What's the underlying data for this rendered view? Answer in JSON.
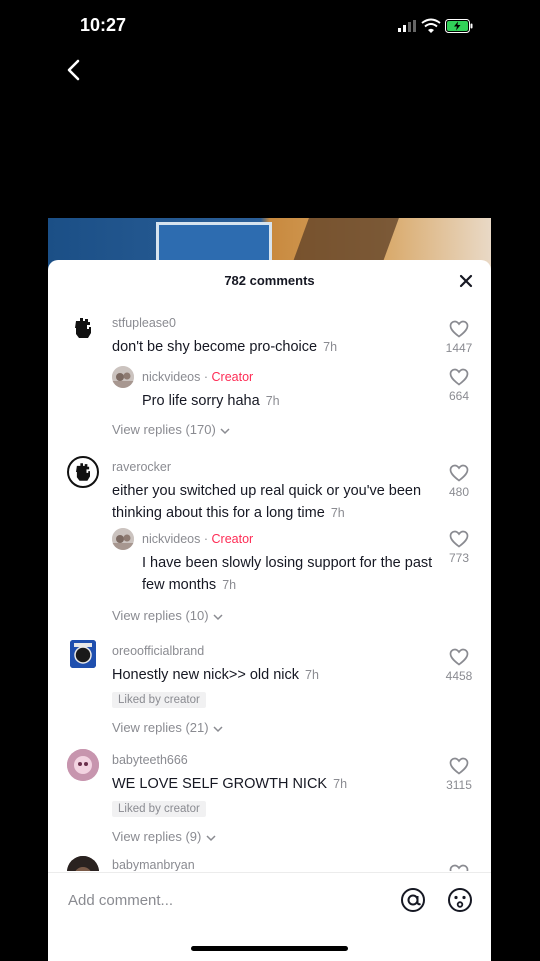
{
  "status_bar": {
    "time": "10:27"
  },
  "icons": {
    "back": "chevron-left-icon",
    "close": "close-icon",
    "like": "heart-outline-icon",
    "at": "at-mention-icon",
    "emoji": "emoji-icon",
    "expand": "chevron-down-icon"
  },
  "colors": {
    "creator": "#fe2c55",
    "secondary_text": "#8a8b91",
    "primary_text": "#161823"
  },
  "sheet": {
    "count_label": "782 comments"
  },
  "comments": [
    {
      "username": "stfuplease0",
      "text": "don't be shy become pro-choice",
      "time": "7h",
      "likes": "1447",
      "reply": {
        "username": "nickvideos",
        "creator_label": "Creator",
        "separator": "·",
        "text": "Pro life sorry haha",
        "time": "7h",
        "likes": "664"
      },
      "view_replies": "View replies (170)"
    },
    {
      "username": "raverocker",
      "text": "either you switched up real quick or you've been thinking about this for a long time",
      "time": "7h",
      "likes": "480",
      "reply": {
        "username": "nickvideos",
        "creator_label": "Creator",
        "separator": "·",
        "text": "I have been slowly losing support for the past few months",
        "time": "7h",
        "likes": "773"
      },
      "view_replies": "View replies (10)"
    },
    {
      "username": "oreoofficialbrand",
      "text": "Honestly new nick>> old nick",
      "time": "7h",
      "likes": "4458",
      "badge": "Liked by creator",
      "view_replies": "View replies (21)"
    },
    {
      "username": "babyteeth666",
      "text": "WE LOVE SELF GROWTH NICK",
      "time": "7h",
      "likes": "3115",
      "badge": "Liked by creator",
      "view_replies": "View replies (9)"
    },
    {
      "username": "babymanbryan"
    }
  ],
  "footer": {
    "placeholder": "Add comment..."
  }
}
